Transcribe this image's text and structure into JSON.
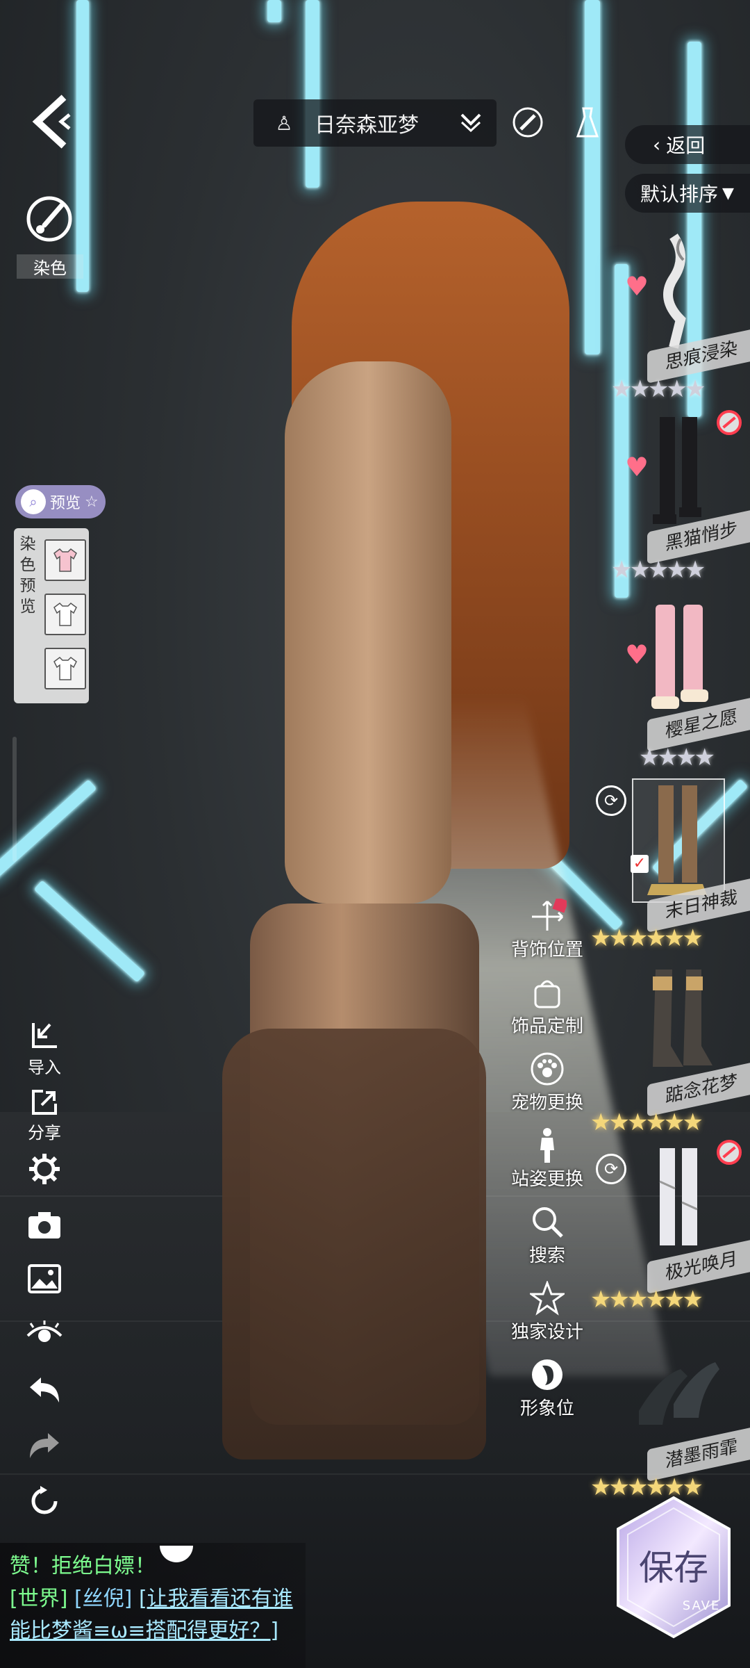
{
  "outfit": {
    "name": "日奈森亚梦",
    "icon": "dress-icon"
  },
  "left_tools": {
    "dye_label": "染色",
    "preview_label": "预览",
    "dye_preview_label": "染色预览",
    "import_label": "导入",
    "share_label": "分享"
  },
  "right_panel": {
    "back_label": "返回",
    "sort_label": "默认排序",
    "items": [
      {
        "name": "思痕浸染",
        "stars": "★★★★★",
        "rarity": "silver",
        "favorite": true,
        "banned": false
      },
      {
        "name": "黑猫悄步",
        "stars": "★★★★★",
        "rarity": "silver",
        "favorite": true,
        "banned": true
      },
      {
        "name": "樱星之愿",
        "stars": "★★★★",
        "rarity": "silver",
        "favorite": true,
        "banned": false
      },
      {
        "name": "末日神裁",
        "stars": "★★★★★★",
        "rarity": "gold",
        "favorite": false,
        "banned": false,
        "selected": true
      },
      {
        "name": "踮念花梦",
        "stars": "★★★★★★",
        "rarity": "gold",
        "favorite": false,
        "banned": false
      },
      {
        "name": "极光唤月",
        "stars": "★★★★★★",
        "rarity": "gold",
        "favorite": false,
        "banned": true
      },
      {
        "name": "潜墨雨霏",
        "stars": "★★★★★★",
        "rarity": "gold",
        "favorite": false,
        "banned": false
      }
    ]
  },
  "mid_menu": [
    {
      "label": "背饰位置",
      "icon": "move-icon"
    },
    {
      "label": "饰品定制",
      "icon": "bag-icon"
    },
    {
      "label": "宠物更换",
      "icon": "paw-icon"
    },
    {
      "label": "站姿更换",
      "icon": "person-icon"
    },
    {
      "label": "搜索",
      "icon": "search-icon"
    },
    {
      "label": "独家设计",
      "icon": "star-icon"
    },
    {
      "label": "形象位",
      "icon": "portrait-icon"
    }
  ],
  "chat": {
    "line1": "赞！拒绝白嫖！",
    "channel": "[世界]",
    "user": "[丝倪]",
    "message": "[让我看看还有谁能比梦酱≡ω≡搭配得更好？]"
  },
  "save": {
    "label": "保存",
    "sub": "SAVE"
  }
}
